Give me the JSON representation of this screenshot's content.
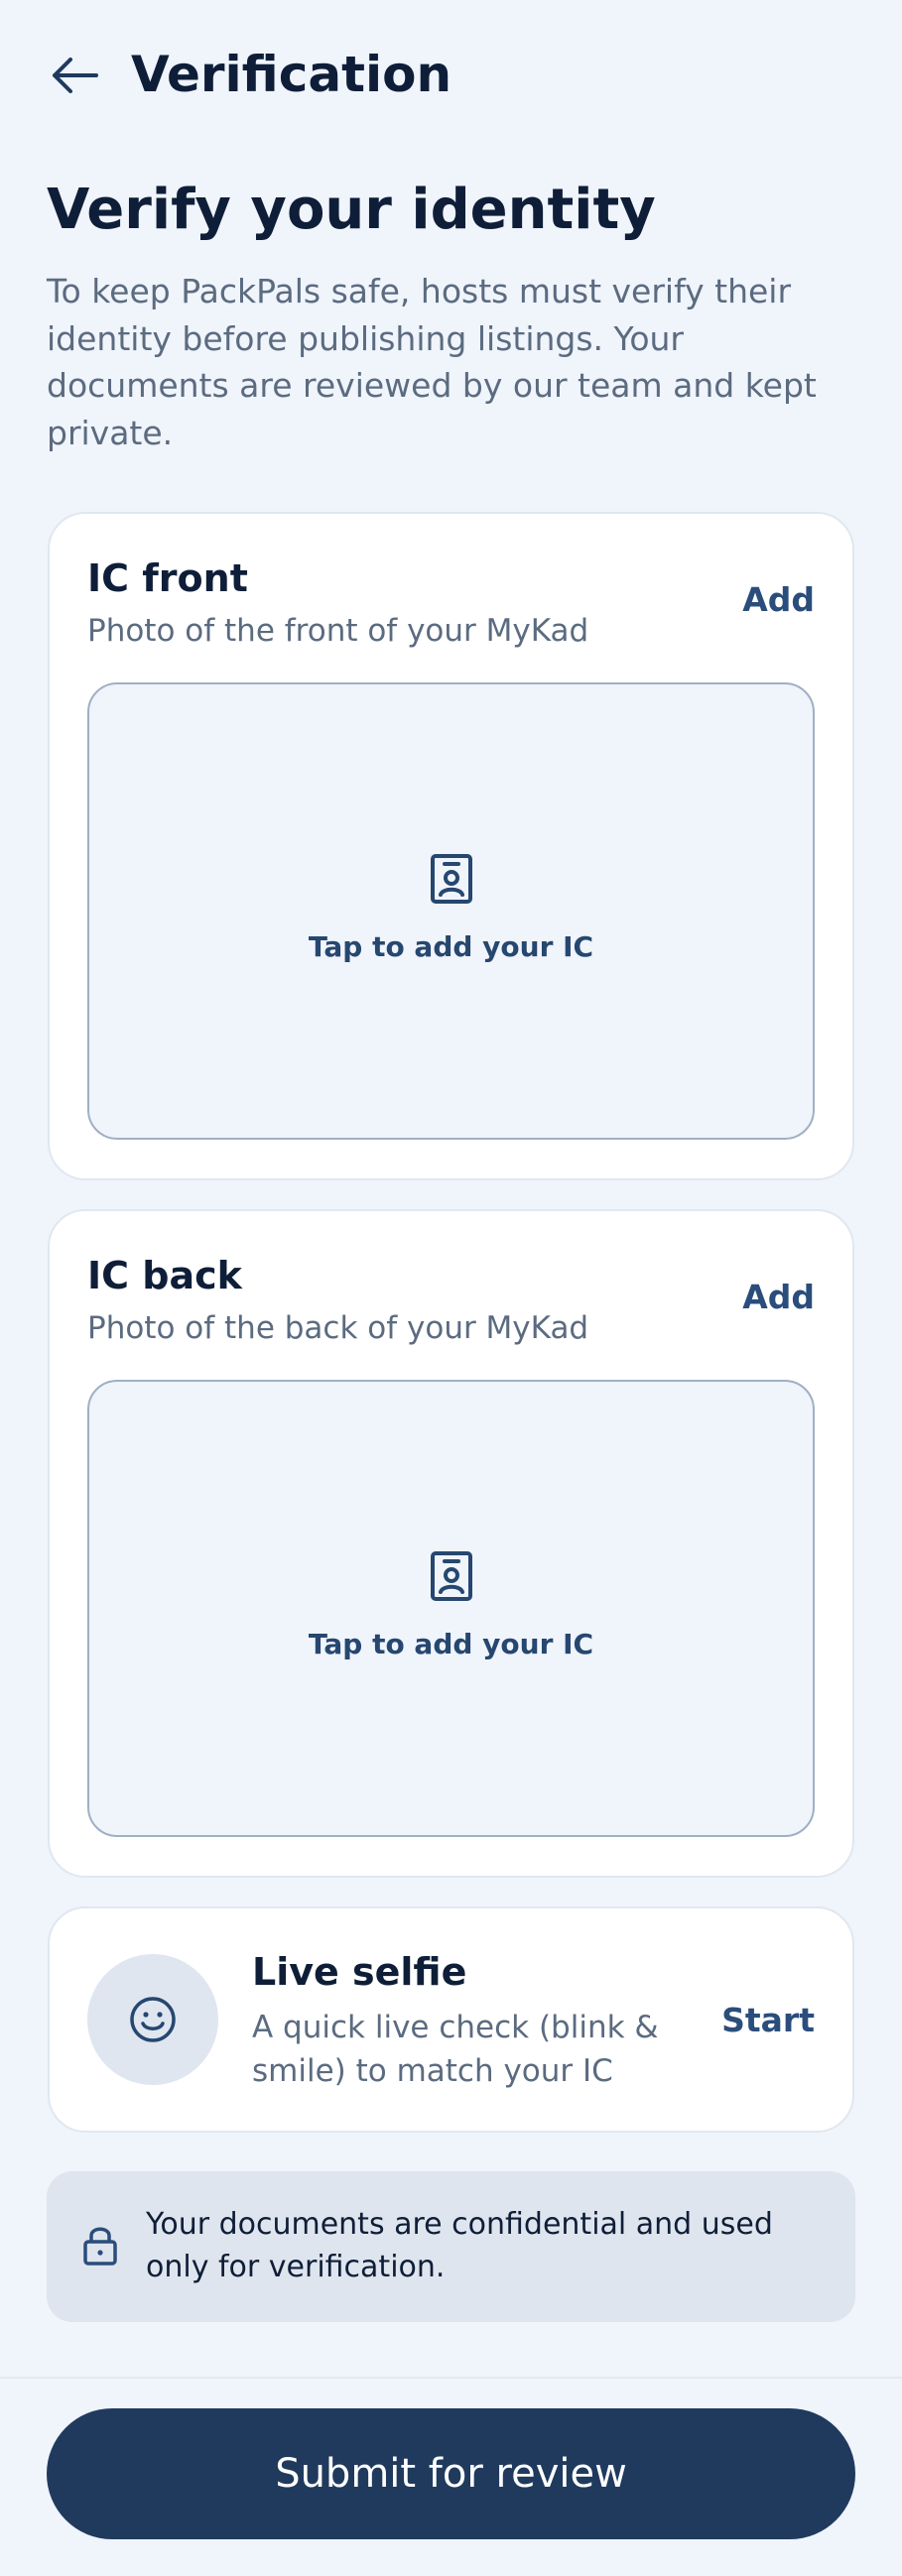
{
  "header": {
    "title": "Verification",
    "back_icon": "arrow-left-icon"
  },
  "page": {
    "title": "Verify your identity",
    "intro": "To keep PackPals safe, hosts must verify their identity before publishing listings. Your documents are reviewed by our team and kept private."
  },
  "documents": [
    {
      "title": "IC front",
      "subtitle": "Photo of the front of your MyKad",
      "action": "Add",
      "dropzone_label": "Tap to add your IC",
      "icon": "id-card-icon"
    },
    {
      "title": "IC back",
      "subtitle": "Photo of the back of your MyKad",
      "action": "Add",
      "dropzone_label": "Tap to add your IC",
      "icon": "id-card-icon"
    }
  ],
  "selfie": {
    "title": "Live selfie",
    "subtitle": "A quick live check (blink & smile) to match your IC",
    "action": "Start",
    "icon": "smile-icon"
  },
  "notice": {
    "text": "Your documents are confidential and used only for verification.",
    "icon": "lock-icon"
  },
  "footer": {
    "submit_label": "Submit for review"
  },
  "colors": {
    "background": "#f0f4fb",
    "primary": "#203a5e",
    "accent_text": "#2a4d7c",
    "muted_text": "#5b6b80",
    "heading_text": "#0f1e38"
  }
}
